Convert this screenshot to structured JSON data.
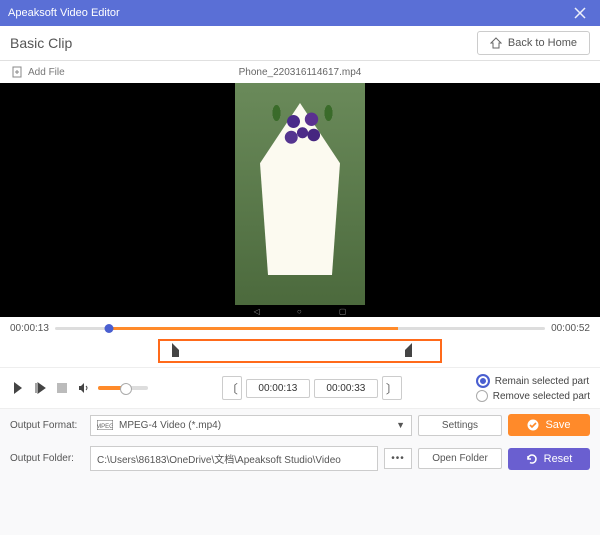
{
  "window": {
    "title": "Apeaksoft Video Editor",
    "close_icon": "close-icon"
  },
  "header": {
    "page_title": "Basic Clip",
    "home_label": "Back to Home"
  },
  "file": {
    "add_label": "Add File",
    "name": "Phone_220316114617.mp4"
  },
  "timeline": {
    "current": "00:00:13",
    "duration": "00:00:52"
  },
  "clip": {
    "start_time": "00:00:13",
    "end_time": "00:00:33",
    "remain_label": "Remain selected part",
    "remove_label": "Remove selected part",
    "mode": "remain"
  },
  "output": {
    "format_label": "Output Format:",
    "format_value": "MPEG-4 Video (*.mp4)",
    "settings_label": "Settings",
    "folder_label": "Output Folder:",
    "folder_value": "C:\\Users\\86183\\OneDrive\\文档\\Apeaksoft Studio\\Video",
    "open_label": "Open Folder"
  },
  "actions": {
    "save_label": "Save",
    "reset_label": "Reset"
  },
  "colors": {
    "accent_primary": "#5a6fd6",
    "accent_orange": "#ff8a2a",
    "accent_purple": "#6a5fd0"
  }
}
